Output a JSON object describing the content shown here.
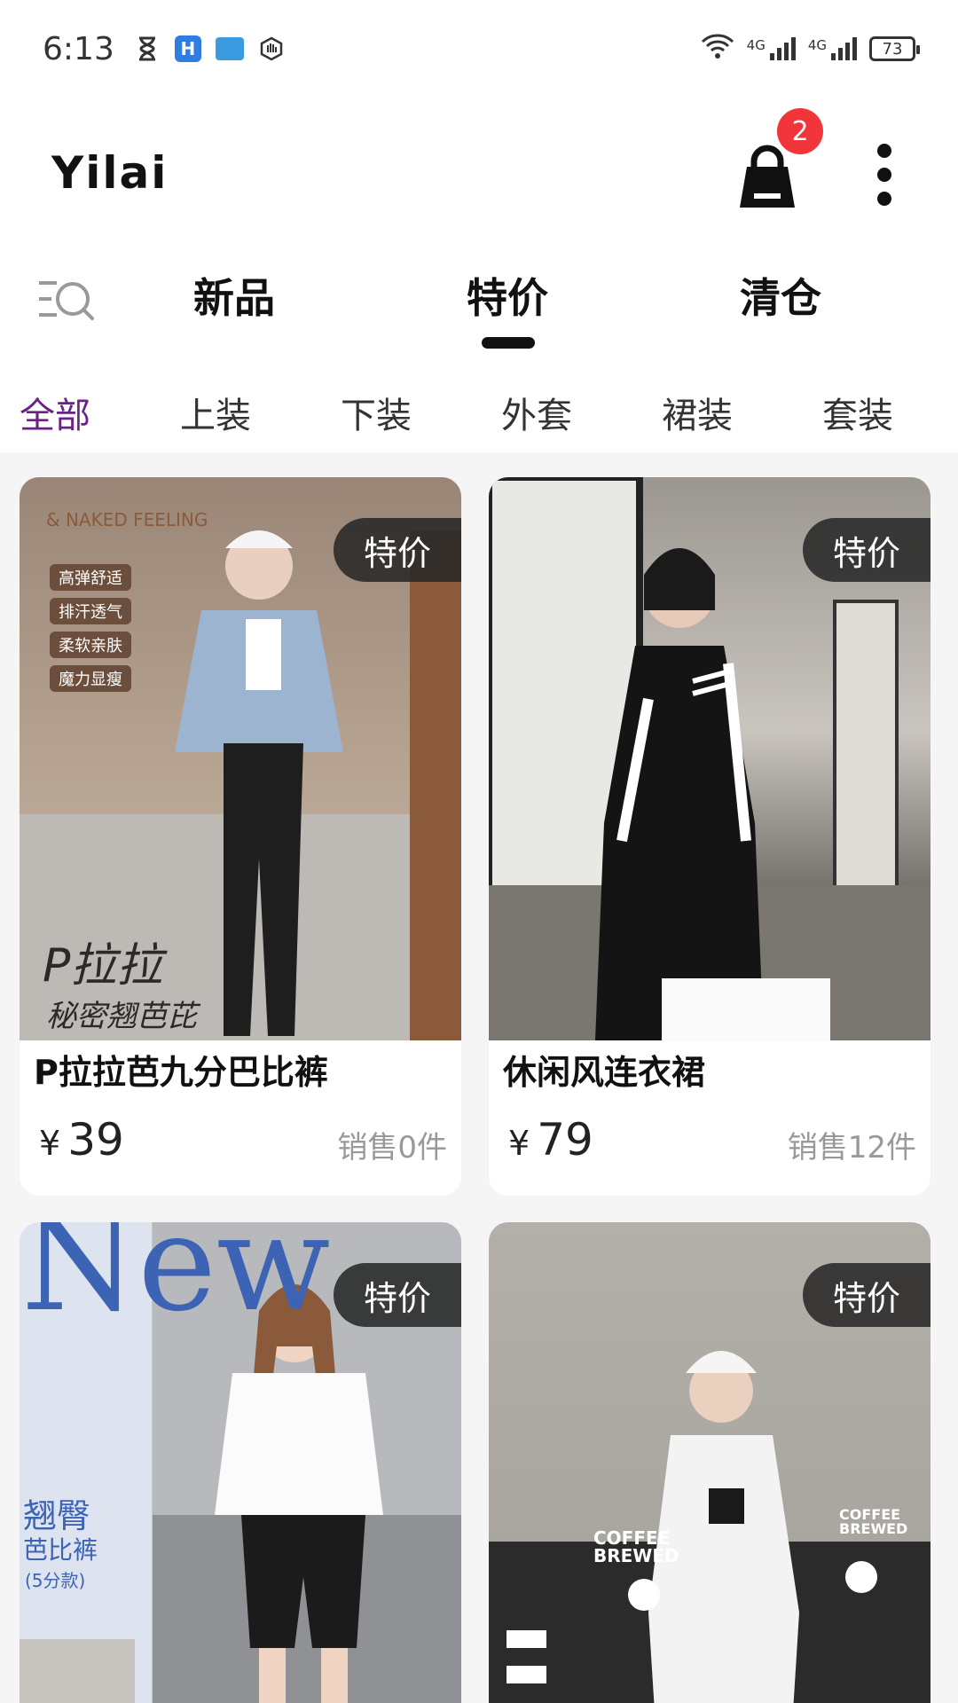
{
  "status_bar": {
    "time": "6:13",
    "battery": "73",
    "network_1": "4G",
    "network_2": "4G"
  },
  "header": {
    "title": "Yilai",
    "cart_badge": "2"
  },
  "main_tabs": [
    {
      "label": "新品"
    },
    {
      "label": "特价"
    },
    {
      "label": "清仓"
    }
  ],
  "categories": [
    {
      "label": "全部"
    },
    {
      "label": "上装"
    },
    {
      "label": "下装"
    },
    {
      "label": "外套"
    },
    {
      "label": "裙装"
    },
    {
      "label": "套装"
    }
  ],
  "products": [
    {
      "tag": "特价",
      "name": "P拉拉芭九分巴比裤",
      "currency": "¥",
      "price": "39",
      "sold": "销售0件",
      "img_text": {
        "t1": "& NAKED FEELING",
        "f1": "高弹舒适",
        "f2": "排汗透气",
        "f3": "柔软亲肤",
        "f4": "魔力显瘦",
        "logo": "P拉拉",
        "sub": "秘密翘芭芘"
      }
    },
    {
      "tag": "特价",
      "name": "休闲风连衣裙",
      "currency": "¥",
      "price": "79",
      "sold": "销售12件"
    },
    {
      "tag": "特价",
      "img_text": {
        "big": "New",
        "t1": "翘臀",
        "t2": "芭比裤",
        "t3": "(5分款)"
      }
    },
    {
      "tag": "特价",
      "img_text": {
        "t1": "COFFEE BREWED",
        "t2": "COFFEE BREWED"
      }
    }
  ],
  "accent_color": "#6a2385",
  "badge_color": "#f2353b"
}
